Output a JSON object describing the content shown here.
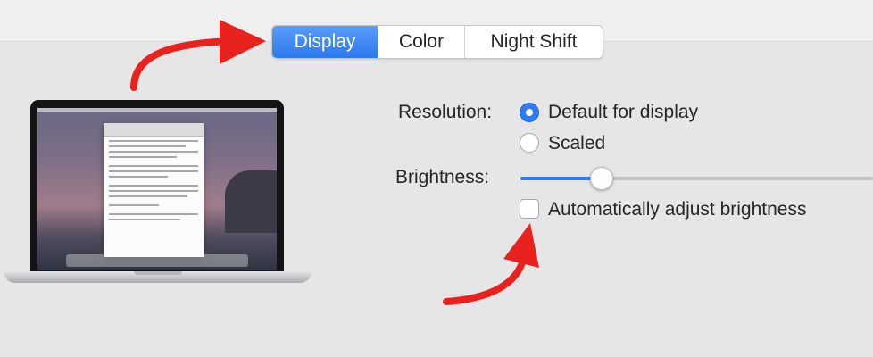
{
  "tabs": [
    {
      "label": "Display",
      "active": true
    },
    {
      "label": "Color",
      "active": false
    },
    {
      "label": "Night Shift",
      "active": false
    }
  ],
  "resolution": {
    "label": "Resolution:",
    "options": [
      {
        "label": "Default for display",
        "selected": true
      },
      {
        "label": "Scaled",
        "selected": false
      }
    ]
  },
  "brightness": {
    "label": "Brightness:",
    "level": 0.23
  },
  "auto_brightness": {
    "label": "Automatically adjust brightness",
    "checked": false
  },
  "colors": {
    "accent": "#2f7bf2",
    "annotation_arrow": "#e8231f",
    "background": "#e6e6e6"
  },
  "icons": [
    "laptop-illustration",
    "annotation-arrow"
  ]
}
